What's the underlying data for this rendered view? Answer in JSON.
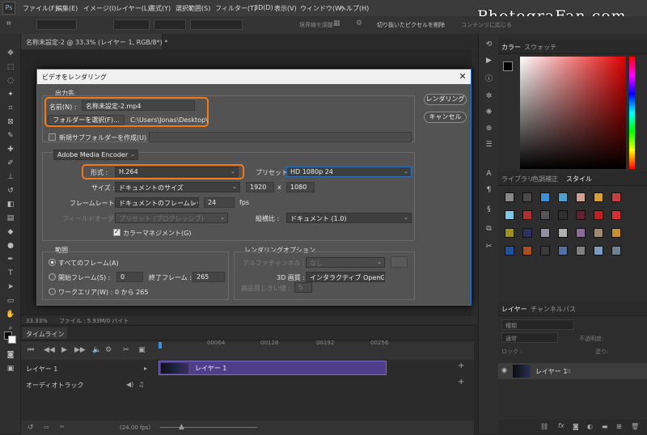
{
  "watermark": "PhotograFan.com",
  "menu": {
    "logo": "Ps",
    "items": [
      "ファイル(F)",
      "編集(E)",
      "イメージ(I)",
      "レイヤー(L)",
      "書式(Y)",
      "選択範囲(S)",
      "フィルター(T)",
      "3D(D)",
      "表示(V)",
      "ウィンドウ(W)",
      "ヘルプ(H)"
    ]
  },
  "options_bar": {
    "refine": "境界線を調整",
    "crop_checkbox": "切り抜いたピクセルを削除",
    "content": "コンテンツに応じる"
  },
  "document": {
    "tab": "名称未設定-2 @ 33.3% (レイヤー 1, RGB/8*) *"
  },
  "status_bar": {
    "zoom": "33.33%",
    "file": "ファイル : 5.93M/0 バイト"
  },
  "timeline": {
    "tab": "タイムライン",
    "ruler": [
      "00064",
      "00128",
      "00192",
      "00256"
    ],
    "layer_row": "レイヤー 1",
    "audio_row": "オーディオトラック",
    "clip_label": "レイヤー 1",
    "fps": "(24.00 fps)"
  },
  "panels": {
    "color_tabs": [
      "カラー",
      "スウォッチ"
    ],
    "style_tabs": [
      "ライブラリ",
      "色調補正",
      "スタイル"
    ],
    "layer_tabs": [
      "レイヤー",
      "チャンネル",
      "パス"
    ],
    "kind": "種類",
    "blend": "通常",
    "opacity_label": "不透明度:",
    "lock_label": "ロック :",
    "fill_label": "塗り:",
    "layer_name": "レイヤー 1",
    "style_colors": [
      "#888888",
      "#4a4a4a",
      "#3d8fd8",
      "#4fa0d0",
      "#d0a090",
      "#d8a030",
      "#c84040",
      "#7ec8e8",
      "#b03030",
      "#555555",
      "#303030",
      "#602030",
      "#c02020",
      "#d83030",
      "#a09020",
      "#303060",
      "#9090a0",
      "#b0b0b0",
      "#8a6a9a",
      "#a08a70",
      "#c89030",
      "#2050a0",
      "#aa5020",
      "#3a3a3a",
      "#5070a0",
      "#808080",
      "#7a9ac0",
      "#708090"
    ]
  },
  "dialog": {
    "title": "ビデオをレンダリング",
    "close": "✕",
    "output_header": "出力先",
    "name_label": "名前(N) :",
    "name_value": "名称未設定-2.mp4",
    "folder_button": "フォルダーを選択(F)...",
    "folder_path": "C:\\Users\\Jonas\\Desktop\\",
    "subfolder_label": "新規サブフォルダーを作成(U) :",
    "encoder": "Adobe Media Encoder",
    "format_label": "形式 :",
    "format_value": "H.264",
    "preset_label": "プリセット :",
    "preset_value": "HD 1080p 24",
    "size_label": "サイズ :",
    "size_value": "ドキュメントのサイズ",
    "width": "1920",
    "times": "x",
    "height": "1080",
    "framerate_label": "フレームレート :",
    "framerate_value": "ドキュメントのフレームレート",
    "fps_value": "24",
    "fps_unit": "fps",
    "field_order_label": "フィールドオーダー :",
    "field_order_value": "プリセット (プログレッシブ)",
    "aspect_label": "縦横比 :",
    "aspect_value": "ドキュメント (1.0)",
    "color_manage": "カラーマネジメント(G)",
    "range_header": "範囲",
    "all_frames": "すべてのフレーム(A)",
    "start_frame": "開始フレーム(S) :",
    "start_value": "0",
    "end_frame": "終了フレーム :",
    "end_value": "265",
    "work_area": "ワークエリア(W) :",
    "work_area_value": "0 から 265",
    "render_options_header": "レンダリングオプション",
    "alpha_label": "アルファチャンネル :",
    "alpha_value": "なし",
    "quality_label": "3D 画質 :",
    "quality_value": "インタラクティブ OpenGL",
    "threshold_label": "高品質しきい値 :",
    "threshold_value": "5",
    "render_button": "レンダリング",
    "cancel_button": "キャンセル"
  }
}
